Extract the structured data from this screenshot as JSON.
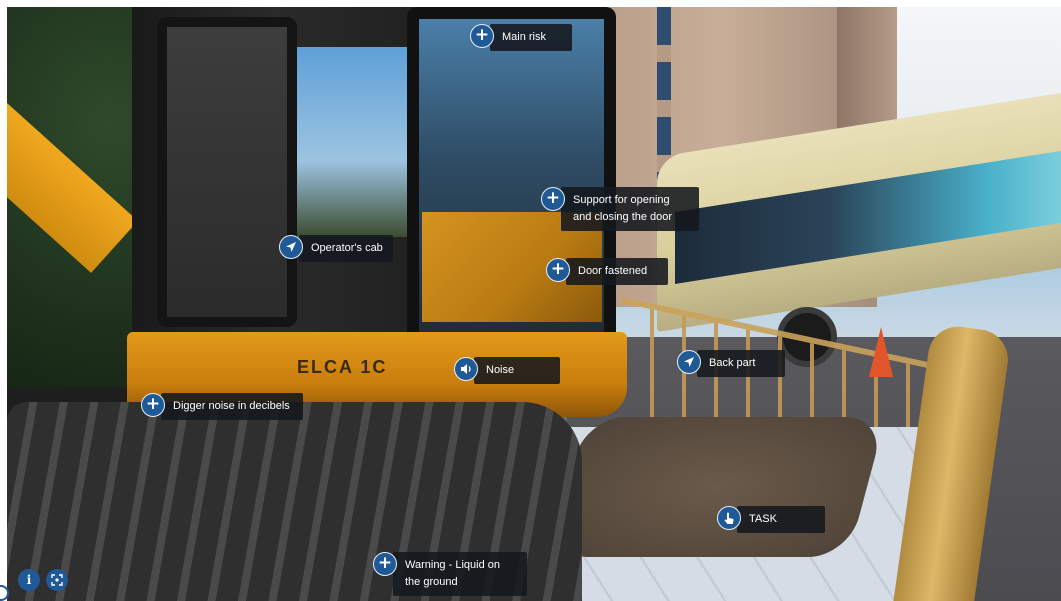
{
  "hotspots": {
    "main_risk": {
      "label": "Main risk",
      "icon": "plus-icon"
    },
    "support_door": {
      "label": "Support for opening and closing the door",
      "icon": "plus-icon"
    },
    "operators_cab": {
      "label": "Operator's cab",
      "icon": "navigate-arrow-icon"
    },
    "door_fastened": {
      "label": "Door fastened",
      "icon": "plus-icon"
    },
    "noise": {
      "label": "Noise",
      "icon": "speaker-icon"
    },
    "back_part": {
      "label": "Back part",
      "icon": "navigate-arrow-icon"
    },
    "digger_noise": {
      "label": "Digger noise in decibels",
      "icon": "plus-icon"
    },
    "task": {
      "label": "TASK",
      "icon": "hand-pointer-icon"
    },
    "warning_liquid": {
      "label": "Warning - Liquid on the ground",
      "icon": "plus-icon"
    }
  },
  "controls": {
    "info": {
      "icon": "info-icon"
    },
    "fullscreen": {
      "icon": "fullscreen-icon"
    }
  },
  "scene": {
    "machine_text": "ELCA 1C",
    "colors": {
      "hotspot_blue": "#1f5a96",
      "label_bg": "#14181e",
      "machine_yellow": "#e39a1a"
    }
  }
}
